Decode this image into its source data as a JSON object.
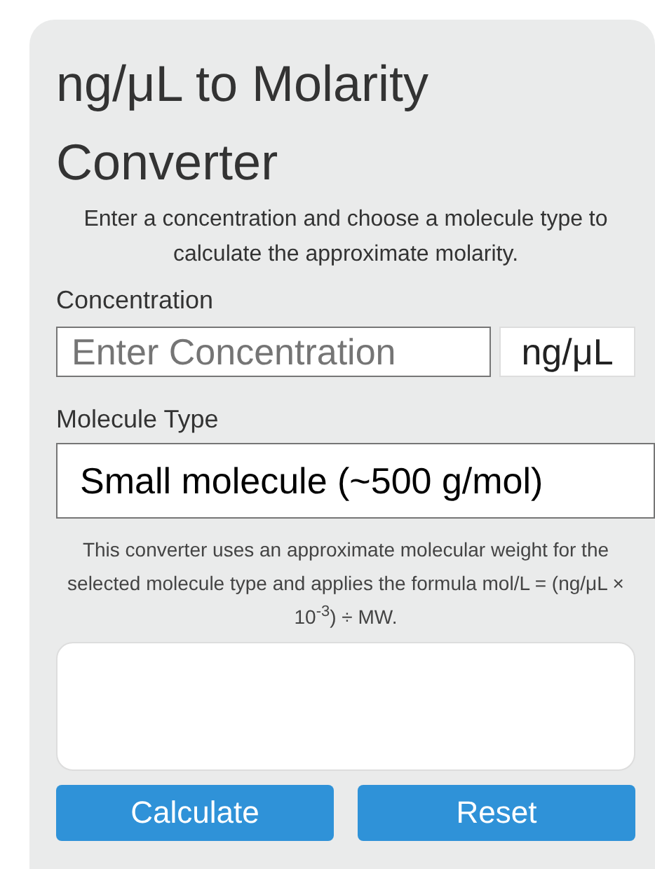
{
  "title": "ng/μL to Molarity Converter",
  "intro": "Enter a concentration and choose a molecule type to calculate the approximate molarity.",
  "concentration": {
    "label": "Concentration",
    "placeholder": "Enter Concentration",
    "unit": "ng/μL"
  },
  "molecule_type": {
    "label": "Molecule Type",
    "value": "Small molecule (~500 g/mol)"
  },
  "note": "This converter uses an approximate molecular weight for the selected molecule type and applies the formula mol/L = (ng/μL × 10$^{-3}$) ÷ MW.",
  "buttons": [
    {
      "label": "Calculate"
    },
    {
      "label": "Reset"
    }
  ]
}
